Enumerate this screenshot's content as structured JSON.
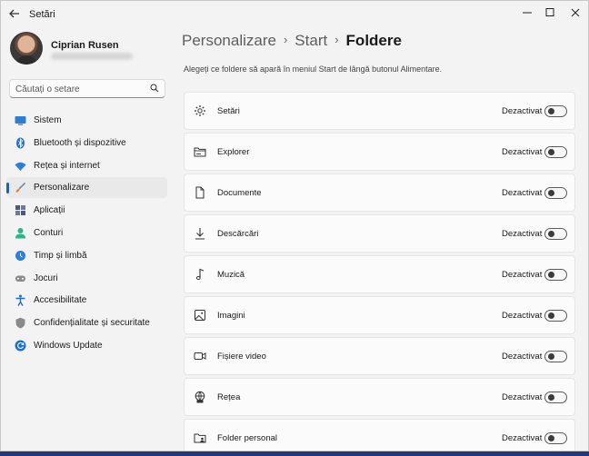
{
  "window": {
    "title": "Setări"
  },
  "profile": {
    "name": "Ciprian Rusen"
  },
  "search": {
    "placeholder": "Căutați o setare"
  },
  "nav": {
    "items": [
      {
        "label": "Sistem",
        "icon": "system-icon",
        "color": "#2d7fd3"
      },
      {
        "label": "Bluetooth și dispozitive",
        "icon": "bluetooth-icon",
        "color": "#1f6fd1"
      },
      {
        "label": "Rețea și internet",
        "icon": "wifi-icon",
        "color": "#2a7de1"
      },
      {
        "label": "Personalizare",
        "icon": "brush-icon",
        "color": "#d9822b"
      },
      {
        "label": "Aplicații",
        "icon": "apps-icon",
        "color": "#4a5a78"
      },
      {
        "label": "Conturi",
        "icon": "account-icon",
        "color": "#2bb38a"
      },
      {
        "label": "Timp și limbă",
        "icon": "time-language-icon",
        "color": "#2a7de1"
      },
      {
        "label": "Jocuri",
        "icon": "gamepad-icon",
        "color": "#7a7a7a"
      },
      {
        "label": "Accesibilitate",
        "icon": "accessibility-icon",
        "color": "#1a6fd6"
      },
      {
        "label": "Confidențialitate și securitate",
        "icon": "shield-icon",
        "color": "#7a7a7a"
      },
      {
        "label": "Windows Update",
        "icon": "update-icon",
        "color": "#1a6fd6"
      }
    ],
    "active_index": 3
  },
  "breadcrumb": {
    "part1": "Personalizare",
    "part2": "Start",
    "current": "Foldere"
  },
  "description": "Alegeți ce foldere să apară în meniul Start de lângă butonul Alimentare.",
  "rows": [
    {
      "label": "Setări",
      "state": "Dezactivat",
      "icon": "settings-gear-icon",
      "on": false
    },
    {
      "label": "Explorer",
      "state": "Dezactivat",
      "icon": "file-explorer-icon",
      "on": false
    },
    {
      "label": "Documente",
      "state": "Dezactivat",
      "icon": "document-icon",
      "on": false
    },
    {
      "label": "Descărcări",
      "state": "Dezactivat",
      "icon": "download-icon",
      "on": false
    },
    {
      "label": "Muzică",
      "state": "Dezactivat",
      "icon": "music-icon",
      "on": false
    },
    {
      "label": "Imagini",
      "state": "Dezactivat",
      "icon": "image-icon",
      "on": false
    },
    {
      "label": "Fișiere video",
      "state": "Dezactivat",
      "icon": "video-icon",
      "on": false
    },
    {
      "label": "Rețea",
      "state": "Dezactivat",
      "icon": "network-icon",
      "on": false
    },
    {
      "label": "Folder personal",
      "state": "Dezactivat",
      "icon": "personal-folder-icon",
      "on": false
    }
  ],
  "accent": "#1a62c4"
}
